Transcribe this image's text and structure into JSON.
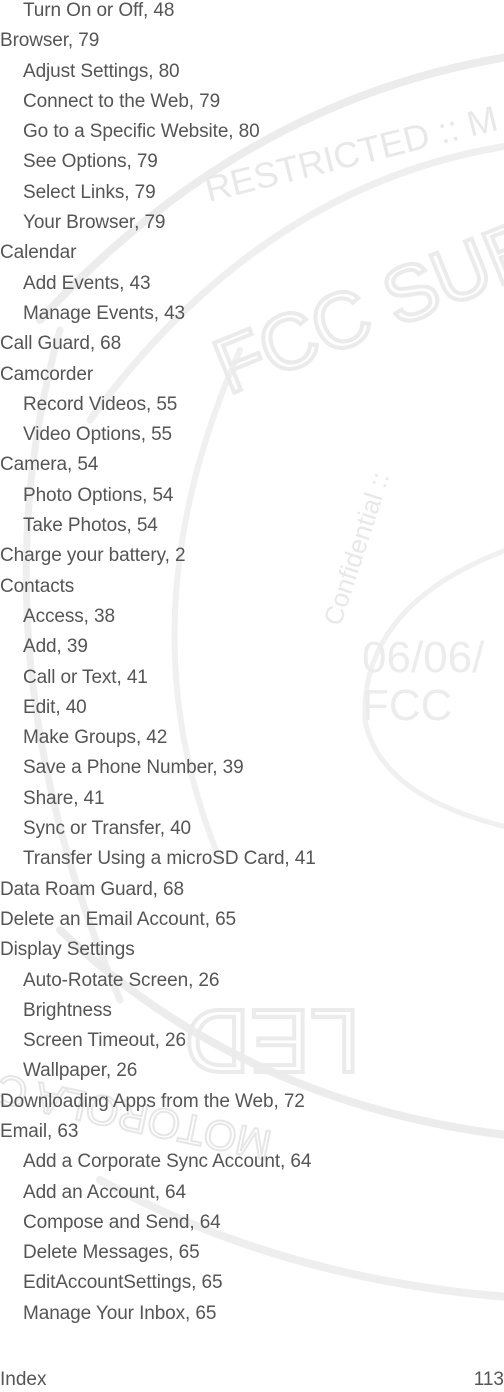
{
  "document": {
    "type": "index-page",
    "entries": [
      {
        "level": 2,
        "text": "Turn On or Off, 48"
      },
      {
        "level": 1,
        "text": "Browser, 79"
      },
      {
        "level": 2,
        "text": "Adjust Settings, 80"
      },
      {
        "level": 2,
        "text": "Connect to the Web, 79"
      },
      {
        "level": 2,
        "text": "Go to a Specific Website, 80"
      },
      {
        "level": 2,
        "text": "See Options, 79"
      },
      {
        "level": 2,
        "text": "Select Links, 79"
      },
      {
        "level": 2,
        "text": "Your Browser, 79"
      },
      {
        "level": 1,
        "text": "Calendar"
      },
      {
        "level": 2,
        "text": "Add Events, 43"
      },
      {
        "level": 2,
        "text": "Manage Events, 43"
      },
      {
        "level": 1,
        "text": "Call Guard, 68"
      },
      {
        "level": 1,
        "text": "Camcorder"
      },
      {
        "level": 2,
        "text": "Record Videos, 55"
      },
      {
        "level": 2,
        "text": "Video Options, 55"
      },
      {
        "level": 1,
        "text": "Camera, 54"
      },
      {
        "level": 2,
        "text": "Photo Options, 54"
      },
      {
        "level": 2,
        "text": "Take Photos, 54"
      },
      {
        "level": 1,
        "text": "Charge your battery, 2"
      },
      {
        "level": 1,
        "text": "Contacts"
      },
      {
        "level": 2,
        "text": "Access, 38"
      },
      {
        "level": 2,
        "text": "Add, 39"
      },
      {
        "level": 2,
        "text": "Call or Text, 41"
      },
      {
        "level": 2,
        "text": "Edit, 40"
      },
      {
        "level": 2,
        "text": "Make Groups, 42"
      },
      {
        "level": 2,
        "text": "Save a Phone Number, 39"
      },
      {
        "level": 2,
        "text": "Share, 41"
      },
      {
        "level": 2,
        "text": "Sync or Transfer, 40"
      },
      {
        "level": 2,
        "text": "Transfer Using a microSD Card, 41"
      },
      {
        "level": 1,
        "text": "Data Roam Guard, 68"
      },
      {
        "level": 1,
        "text": "Delete an Email Account, 65"
      },
      {
        "level": 1,
        "text": "Display Settings"
      },
      {
        "level": 2,
        "text": "Auto-Rotate Screen, 26"
      },
      {
        "level": 2,
        "text": "Brightness"
      },
      {
        "level": 2,
        "text": "Screen Timeout, 26"
      },
      {
        "level": 2,
        "text": "Wallpaper, 26"
      },
      {
        "level": 1,
        "text": "Downloading Apps from the Web, 72"
      },
      {
        "level": 1,
        "text": "Email, 63"
      },
      {
        "level": 2,
        "text": "Add a Corporate Sync Account, 64"
      },
      {
        "level": 2,
        "text": "Add an Account, 64"
      },
      {
        "level": 2,
        "text": "Compose and Send, 64"
      },
      {
        "level": 2,
        "text": "Delete Messages, 65"
      },
      {
        "level": 2,
        "text": "EditAccountSettings, 65"
      },
      {
        "level": 2,
        "text": "Manage Your Inbox, 65"
      }
    ],
    "footer": {
      "section": "Index",
      "page_number": "113"
    }
  },
  "watermark": {
    "texts": {
      "arc_top": "RESTRICTED :: M",
      "center": "FCC SUBM",
      "side": "Confidential ::",
      "date": "06/06/",
      "agency": "FCC",
      "lower": "LED",
      "bottom_arc": "MOTOROLA C"
    },
    "color": "#e6e6e6"
  },
  "colors": {
    "text": "#555555",
    "background": "#ffffff"
  }
}
